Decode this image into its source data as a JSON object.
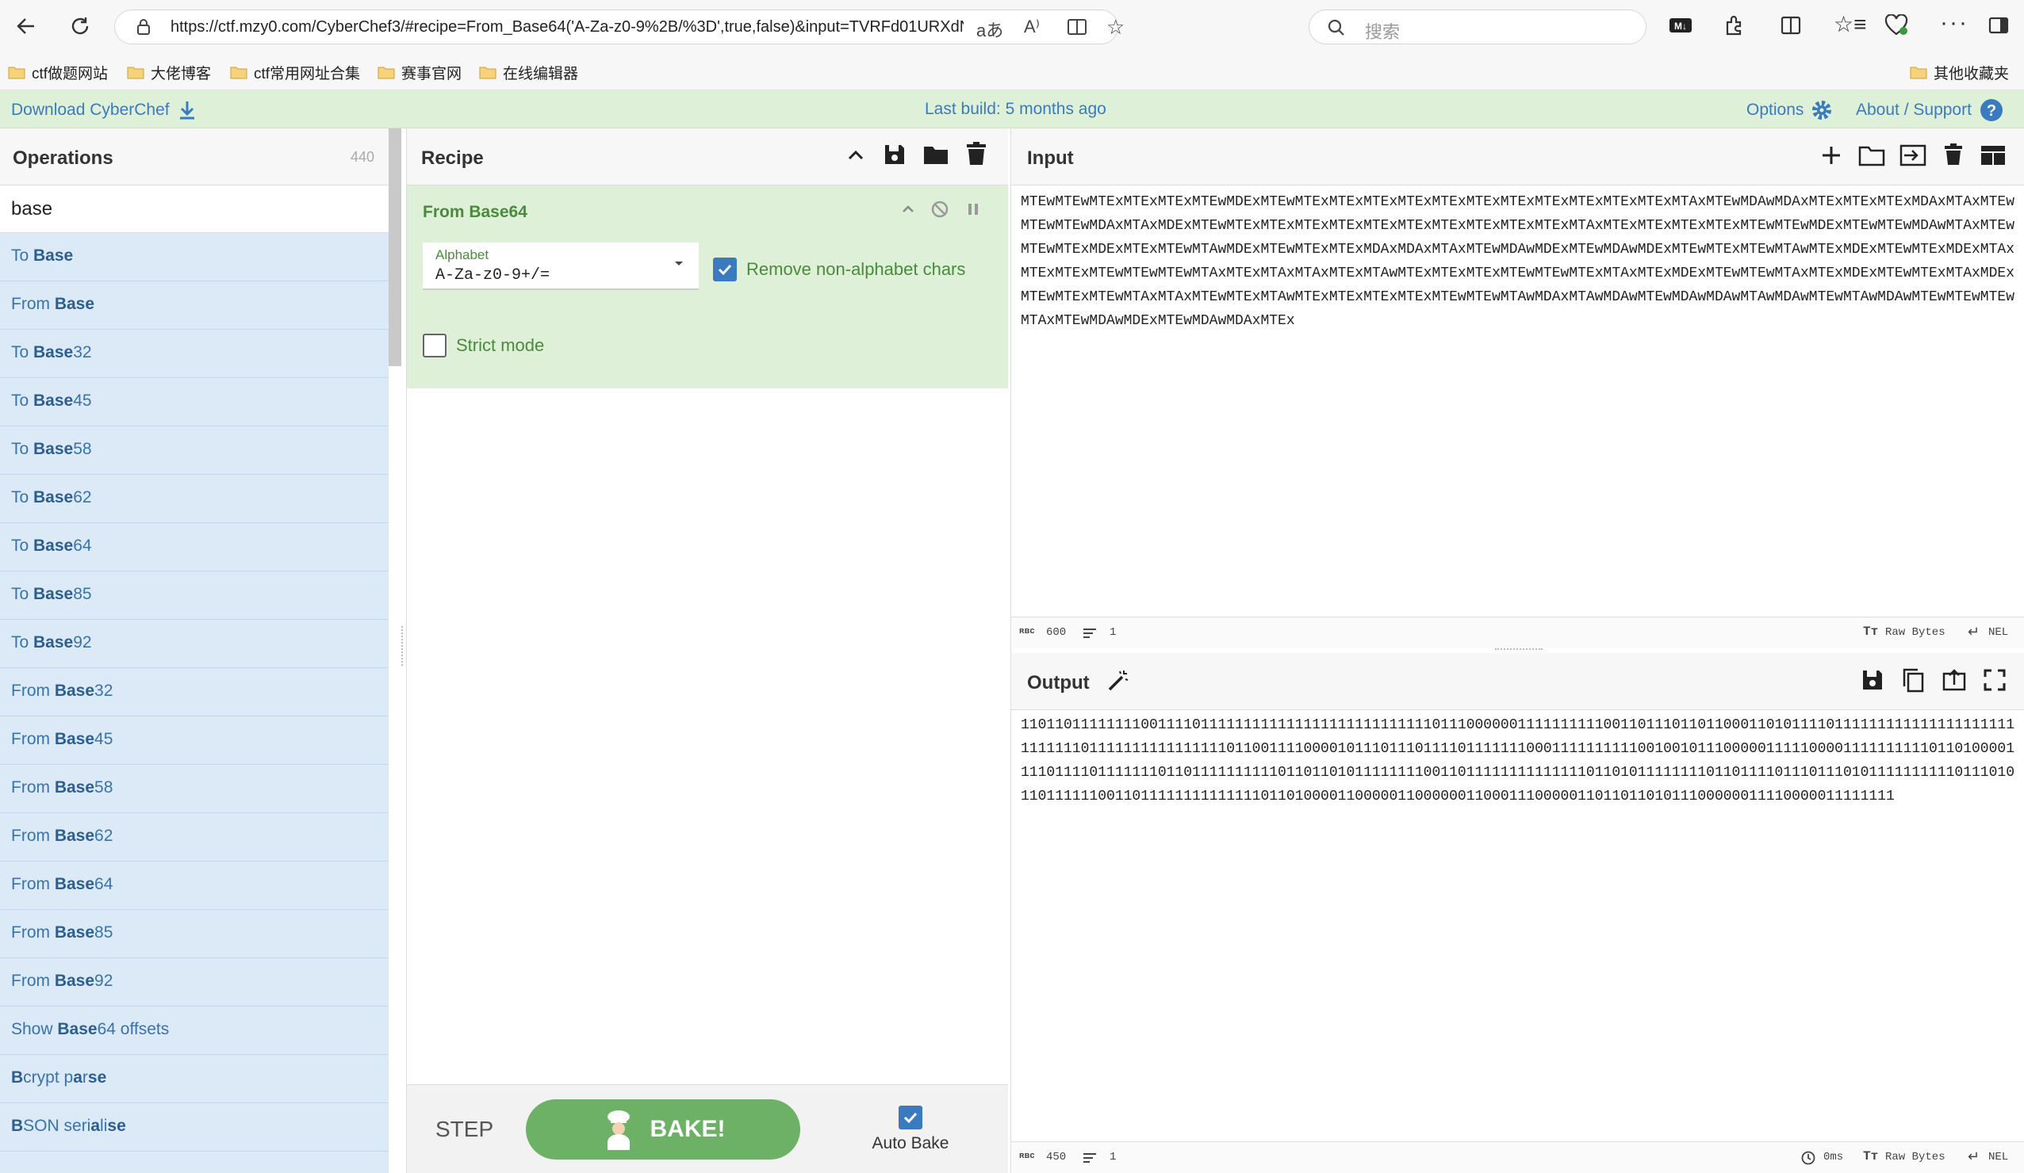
{
  "browser": {
    "url": "https://ctf.mzy0.com/CyberChef3/#recipe=From_Base64('A-Za-z0-9%2B/%3D',true,false)&input=TVRFd01URXdNVEV4TVRF...",
    "search_placeholder": "搜索",
    "bookmarks": [
      "ctf做题网站",
      "大佬博客",
      "ctf常用网址合集",
      "赛事官网",
      "在线编辑器"
    ],
    "other_bookmarks": "其他收藏夹"
  },
  "banner": {
    "download": "Download CyberChef",
    "last_build": "Last build: 5 months ago",
    "options": "Options",
    "about": "About / Support"
  },
  "operations": {
    "title": "Operations",
    "count": "440",
    "search_value": "base",
    "items": [
      {
        "pre": "To ",
        "match": "Base",
        "post": ""
      },
      {
        "pre": "From ",
        "match": "Base",
        "post": ""
      },
      {
        "pre": "To ",
        "match": "Base",
        "post": "32"
      },
      {
        "pre": "To ",
        "match": "Base",
        "post": "45"
      },
      {
        "pre": "To ",
        "match": "Base",
        "post": "58"
      },
      {
        "pre": "To ",
        "match": "Base",
        "post": "62"
      },
      {
        "pre": "To ",
        "match": "Base",
        "post": "64"
      },
      {
        "pre": "To ",
        "match": "Base",
        "post": "85"
      },
      {
        "pre": "To ",
        "match": "Base",
        "post": "92"
      },
      {
        "pre": "From ",
        "match": "Base",
        "post": "32"
      },
      {
        "pre": "From ",
        "match": "Base",
        "post": "45"
      },
      {
        "pre": "From ",
        "match": "Base",
        "post": "58"
      },
      {
        "pre": "From ",
        "match": "Base",
        "post": "62"
      },
      {
        "pre": "From ",
        "match": "Base",
        "post": "64"
      },
      {
        "pre": "From ",
        "match": "Base",
        "post": "85"
      },
      {
        "pre": "From ",
        "match": "Base",
        "post": "92"
      },
      {
        "pre": "Show ",
        "match": "Base",
        "post": "64 offsets"
      },
      {
        "pre": "",
        "match": "B",
        "post": "crypt p",
        "match2": "a",
        "post2": "r",
        "match3": "s",
        "post3": "",
        "match4": "e",
        "post4": ""
      },
      {
        "pre": "",
        "match": "B",
        "post": "SON seri",
        "match2": "a",
        "post2": "li",
        "match3": "s",
        "post3": "",
        "match4": "e",
        "post4": ""
      }
    ]
  },
  "recipe": {
    "title": "Recipe",
    "operation_name": "From Base64",
    "alphabet_label": "Alphabet",
    "alphabet_value": "A-Za-z0-9+/=",
    "remove_label": "Remove non-alphabet chars",
    "remove_checked": true,
    "strict_label": "Strict mode",
    "strict_checked": false,
    "step_label": "STEP",
    "bake_label": "BAKE!",
    "autobake_label": "Auto Bake",
    "autobake_checked": true
  },
  "input": {
    "title": "Input",
    "text": "MTEwMTEwMTExMTExMTExMTEwMDExMTEwMTExMTExMTExMTExMTExMTExMTExMTExMTExMTExMTExMTAxMTEwMDAwMDAxMTExMTExMTExMDAxMTAxMTEwMTEwMTEwMDAxMTAxMDExMTEwMTExMTExMTExMTExMTExMTExMTExMTExMTExMTExMTAxMTExMTExMTExMTExMTEwMTEwMDExMTEwMTEwMDAwMTAxMTEwMTEwMTExMDExMTExMTEwMTAwMDExMTEwMTExMTExMDAxMDAxMTAxMTEwMDAwMDExMTEwMDAwMDExMTEwMTExMTEwMTAwMTExMDExMTEwMTExMDExMTAxMTExMTExMTEwMTEwMTEwMTAxMTExMTAxMTAxMTExMTAwMTExMTExMTExMTEwMTEwMTExMTAxMTExMDExMTEwMTEwMTAxMTExMDExMTEwMTExMTAxMDExMTEwMTExMTEwMTAxMTAxMTEwMTExMTAwMTExMTExMTExMTExMTEwMTEwMTAwMDAxMTAwMDAwMTEwMDAwMDAwMTAwMDAwMTEwMTAwMDAwMTEwMTEwMTEwMTAxMTEwMDAwMDExMTEwMDAwMDAxMTEx",
    "length": "600",
    "lines": "1",
    "encoding": "Raw Bytes",
    "eol": "NEL"
  },
  "output": {
    "title": "Output",
    "text": "110110111111110011110111111111111111111111111111011100000011111111110011011101101100011010111101111111111111111111111111111011111111111111110110011110000101110111011110111111100011111111110010010111000001111100001111111111011010000111101111011111110110111111111101101101011111111001101111111111111101101011111111011011110111011101011111111110111010110111111001101111111111111101101000011000001100000011000111000001101101101011100000011110000011111111",
    "length": "450",
    "lines": "1",
    "time": "0ms",
    "encoding": "Raw Bytes",
    "eol": "NEL"
  },
  "colors": {
    "banner_bg": "#dff0d8",
    "op_bg": "#dce9f6",
    "bake_green": "#6cb165",
    "link_blue": "#3a7bbf"
  }
}
